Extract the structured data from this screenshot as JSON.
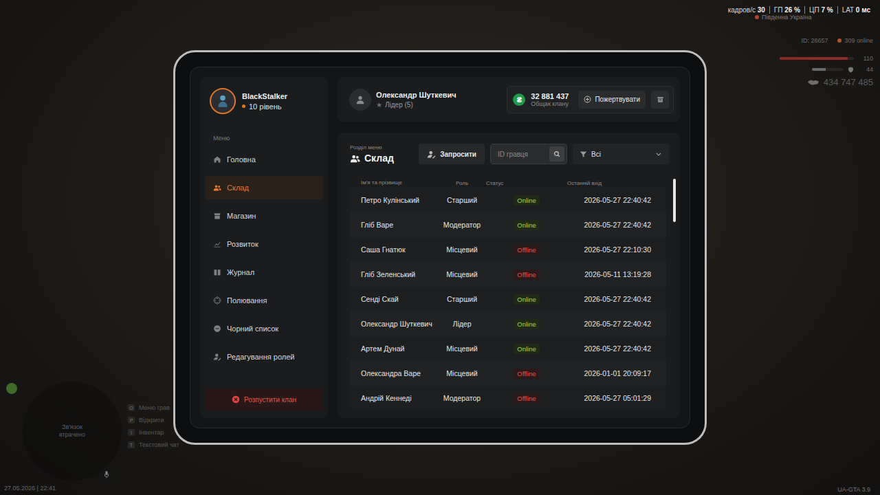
{
  "hud": {
    "fps_label": "кадров/с",
    "fps": "30",
    "gpu_label": "ГП",
    "gpu": "26 %",
    "cpu_label": "ЦП",
    "cpu": "7 %",
    "lat_label": "LAT",
    "lat": "0 мс",
    "region": "Південна Україна",
    "player_id": "ID: 26657",
    "online": "309 online",
    "health": "110",
    "health_level": 0.92,
    "armor": "44",
    "armor_level": 0.44,
    "money": "434 747 485",
    "datetime": "27.05.2026 | 22:41",
    "version": "UA-GTA 3.9",
    "minimap_text": "Зв'язок втрачено"
  },
  "hints": [
    {
      "key": "O",
      "label": "Меню грав"
    },
    {
      "key": "P",
      "label": "Відкрити"
    },
    {
      "key": "I",
      "label": "Інвентар"
    },
    {
      "key": "T",
      "label": "Текстовий чат"
    }
  ],
  "profile": {
    "name": "BlackStalker",
    "level": "10 рівень"
  },
  "sidebar": {
    "heading": "Меню",
    "items": [
      {
        "label": "Головна",
        "selected": false
      },
      {
        "label": "Склад",
        "selected": true
      },
      {
        "label": "Магазин",
        "selected": false
      },
      {
        "label": "Розвиток",
        "selected": false
      },
      {
        "label": "Журнал",
        "selected": false
      },
      {
        "label": "Полювання",
        "selected": false
      },
      {
        "label": "Чорний список",
        "selected": false
      },
      {
        "label": "Редагування ролей",
        "selected": false
      }
    ],
    "dissolve_button": "Розпустити клан"
  },
  "header": {
    "leader_name": "Олександр Шуткевич",
    "star": "★",
    "leader_role": "Лідер (5)",
    "currency_icon": "₴",
    "treasury": "32 881 437",
    "treasury_label": "Общак клану",
    "donate_button": "Пожертвувати"
  },
  "section": {
    "caption": "Розділ меню",
    "title": "Склад",
    "invite_button": "Запросити",
    "search_placeholder": "ID гравця",
    "filter": "Всі"
  },
  "table": {
    "columns": [
      "Ім'я та прізвище",
      "Роль",
      "Статус",
      "Останній вхід"
    ],
    "rows": [
      {
        "name": "Петро Кулінський",
        "role": "Старший",
        "status": "Online",
        "online": true,
        "last_login": "2026-05-27 22:40:42"
      },
      {
        "name": "Гліб Варе",
        "role": "Модератор",
        "status": "Online",
        "online": true,
        "last_login": "2026-05-27 22:40:42"
      },
      {
        "name": "Саша Гнатюк",
        "role": "Місцевий",
        "status": "Offline",
        "online": false,
        "last_login": "2026-05-27 22:10:30"
      },
      {
        "name": "Гліб Зеленський",
        "role": "Місцевий",
        "status": "Offline",
        "online": false,
        "last_login": "2026-05-11 13:19:28"
      },
      {
        "name": "Сенді Скай",
        "role": "Старший",
        "status": "Online",
        "online": true,
        "last_login": "2026-05-27 22:40:42"
      },
      {
        "name": "Олександр Шуткевич",
        "role": "Лідер",
        "status": "Online",
        "online": true,
        "last_login": "2026-05-27 22:40:42"
      },
      {
        "name": "Артем Дунай",
        "role": "Місцевий",
        "status": "Online",
        "online": true,
        "last_login": "2026-05-27 22:40:42"
      },
      {
        "name": "Олександра Варе",
        "role": "Місцевий",
        "status": "Offline",
        "online": false,
        "last_login": "2026-01-01 20:09:17"
      },
      {
        "name": "Андрій Кеннеді",
        "role": "Модератор",
        "status": "Offline",
        "online": false,
        "last_login": "2026-05-27 05:01:29"
      }
    ],
    "scrollbar": {
      "level": 0.16
    }
  }
}
